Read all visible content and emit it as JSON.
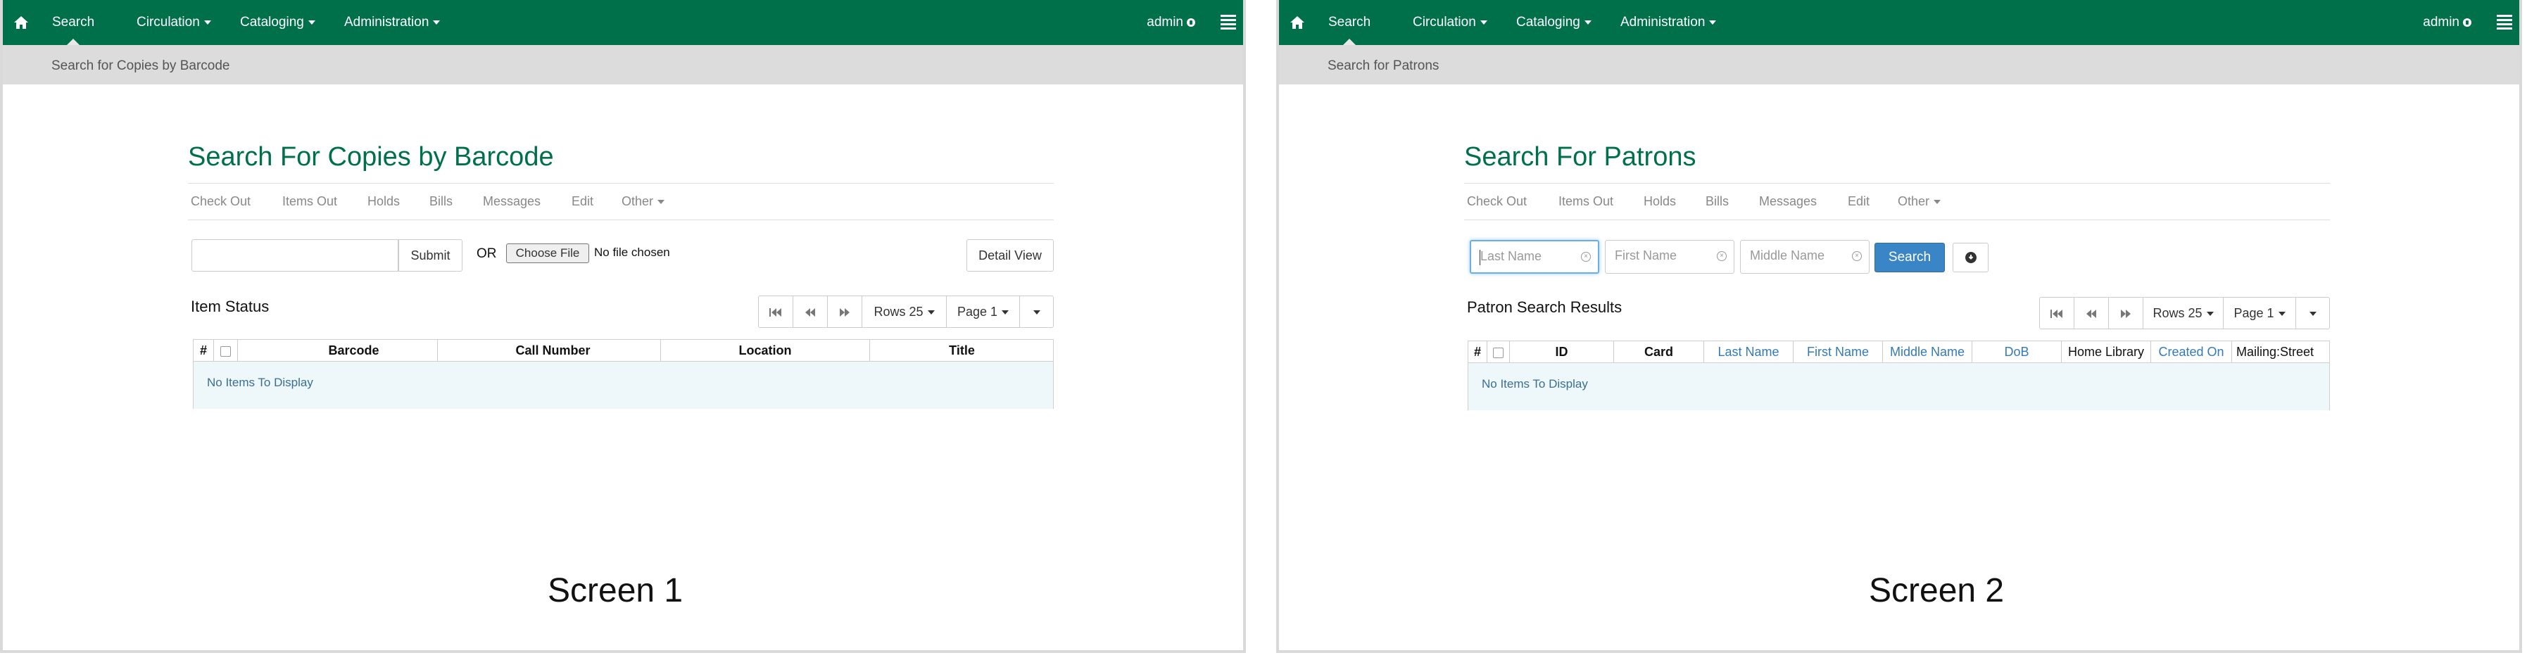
{
  "screens": [
    {
      "navbar": {
        "items": [
          {
            "label": "Search"
          },
          {
            "label": "Circulation"
          },
          {
            "label": "Cataloging"
          },
          {
            "label": "Administration"
          }
        ],
        "user": "admin"
      },
      "breadcrumb": "Search for Copies by Barcode",
      "title": "Search For Copies by Barcode",
      "actions": [
        "Check Out",
        "Items Out",
        "Holds",
        "Bills",
        "Messages",
        "Edit",
        "Other"
      ],
      "search": {
        "barcode_value": "",
        "submit_label": "Submit",
        "or_label": "OR",
        "choose_file_label": "Choose File",
        "file_status": "No file chosen",
        "detail_view_label": "Detail View"
      },
      "section_title": "Item Status",
      "pager": {
        "rows_label": "Rows 25",
        "page_label": "Page 1"
      },
      "columns": [
        "#",
        "",
        "Barcode",
        "Call Number",
        "Location",
        "Title"
      ],
      "empty_message": "No Items To Display",
      "screen_label": "Screen 1"
    },
    {
      "navbar": {
        "items": [
          {
            "label": "Search"
          },
          {
            "label": "Circulation"
          },
          {
            "label": "Cataloging"
          },
          {
            "label": "Administration"
          }
        ],
        "user": "admin"
      },
      "breadcrumb": "Search for Patrons",
      "title": "Search For Patrons",
      "actions": [
        "Check Out",
        "Items Out",
        "Holds",
        "Bills",
        "Messages",
        "Edit",
        "Other"
      ],
      "search": {
        "last_name_placeholder": "Last Name",
        "first_name_placeholder": "First Name",
        "middle_name_placeholder": "Middle Name",
        "search_label": "Search"
      },
      "section_title": "Patron Search Results",
      "pager": {
        "rows_label": "Rows 25",
        "page_label": "Page 1"
      },
      "columns": [
        "#",
        "",
        "ID",
        "Card",
        "Last Name",
        "First Name",
        "Middle Name",
        "DoB",
        "Home Library",
        "Created On",
        "Mailing:Street"
      ],
      "empty_message": "No Items To Display",
      "screen_label": "Screen 2"
    }
  ],
  "colors": {
    "navbar": "#00704a",
    "title": "#00704a",
    "primary_button": "#3a85c6",
    "link": "#337ab7"
  },
  "icons": [
    "home-icon",
    "gear-icon",
    "list-menu-icon",
    "first-page-icon",
    "previous-page-icon",
    "next-page-icon",
    "clear-icon",
    "info-circle-icon",
    "chevron-down-icon"
  ]
}
